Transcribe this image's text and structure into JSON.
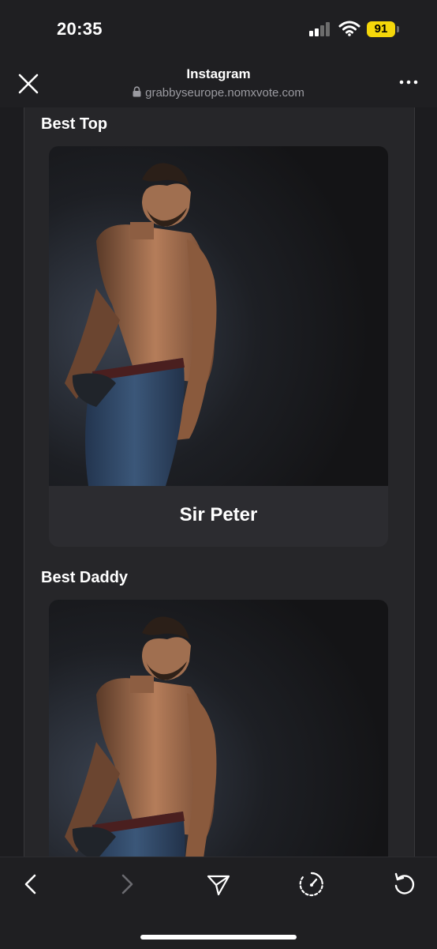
{
  "status_bar": {
    "time": "20:35",
    "battery_level": "91",
    "battery_color": "#f5d70a"
  },
  "header": {
    "title": "Instagram",
    "url": "grabbyseurope.nomxvote.com",
    "icons": {
      "close": "close-icon",
      "lock": "lock-icon",
      "more": "more-icon"
    }
  },
  "sections": [
    {
      "title": "Best Top",
      "nominee": "Sir Peter"
    },
    {
      "title": "Best Daddy"
    }
  ],
  "toolbar": {
    "icons": [
      "back-icon",
      "forward-icon",
      "share-icon",
      "speed-icon",
      "reload-icon"
    ],
    "forward_enabled": false
  }
}
